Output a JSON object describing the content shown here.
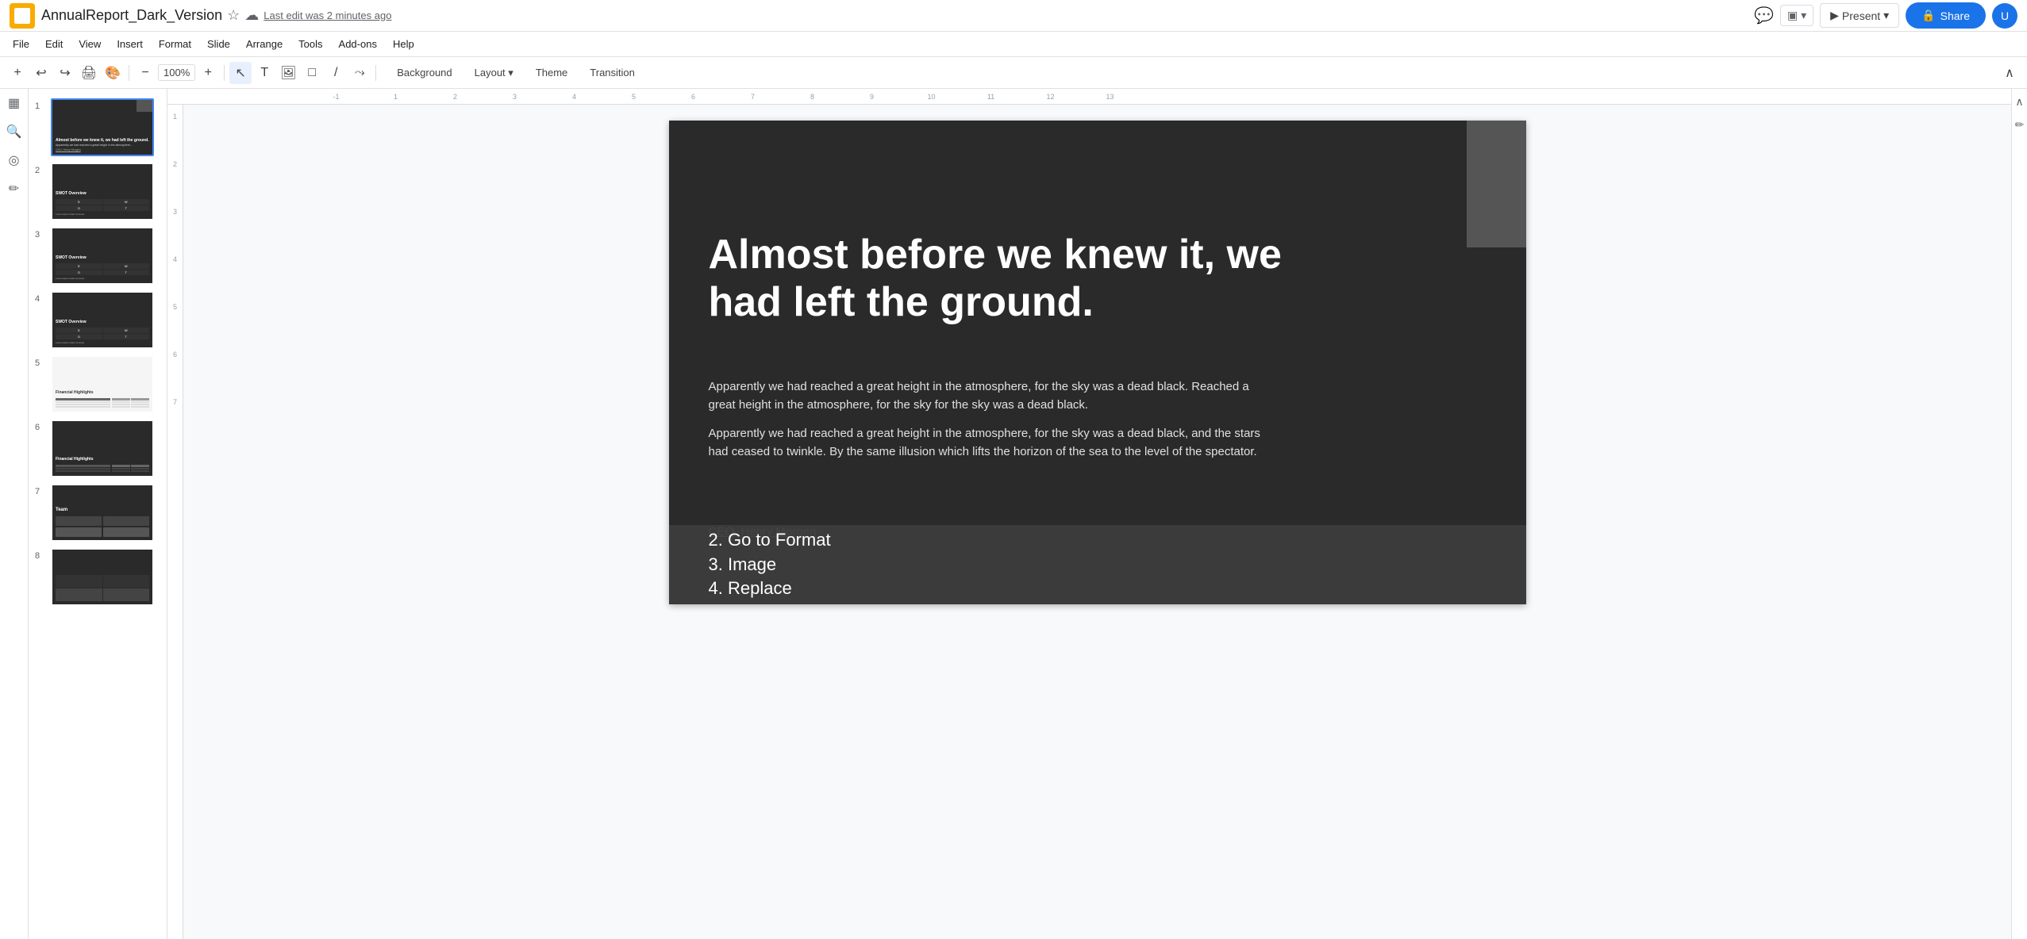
{
  "app": {
    "title": "AnnualReport_Dark_Version",
    "icon_color": "#f9ab00",
    "last_edit": "Last edit was 2 minutes ago"
  },
  "menu": {
    "items": [
      "File",
      "Edit",
      "View",
      "Insert",
      "Format",
      "Slide",
      "Arrange",
      "Tools",
      "Add-ons",
      "Help"
    ]
  },
  "toolbar": {
    "zoom": "▾",
    "background_label": "Background",
    "layout_label": "Layout",
    "theme_label": "Theme",
    "transition_label": "Transition"
  },
  "header_buttons": {
    "present_label": "Present",
    "share_label": "Share",
    "user_initial": "U"
  },
  "slides": [
    {
      "number": "1",
      "title": "Almost before we knew it, we had left the ground.",
      "type": "title"
    },
    {
      "number": "2",
      "title": "SWOT Overview",
      "type": "swot"
    },
    {
      "number": "3",
      "title": "SWOT Overview",
      "type": "swot"
    },
    {
      "number": "4",
      "title": "SWOT Overview",
      "type": "swot"
    },
    {
      "number": "5",
      "title": "Financial Highlights",
      "type": "financial"
    },
    {
      "number": "6",
      "title": "Financial Highlights",
      "type": "financial-dark"
    },
    {
      "number": "7",
      "title": "Team",
      "type": "team"
    },
    {
      "number": "8",
      "title": "",
      "type": "dark-grid"
    }
  ],
  "slide_content": {
    "title": "Almost before we knew it, we had left the ground.",
    "paragraph1": "Apparently we had reached a great height in the atmosphere, for the sky was a dead black. Reached a great height in the atmosphere, for the sky for the sky was a dead black.",
    "paragraph2": "Apparently we had reached a great height in the atmosphere, for the sky was a dead black, and the stars had ceased to twinkle. By the same illusion which lifts the horizon of the sea to the level of the spectator.",
    "ceo_label": "CEO, Henry Morgen"
  },
  "popup": {
    "items": [
      "2. Go to Format",
      "3. Image",
      "4. Replace"
    ]
  },
  "ruler": {
    "numbers": [
      "-1",
      "1",
      "2",
      "3",
      "4",
      "5",
      "6",
      "7",
      "8",
      "9",
      "10",
      "11",
      "12",
      "13"
    ],
    "v_numbers": [
      "1",
      "2",
      "3",
      "4",
      "5",
      "6",
      "7"
    ]
  }
}
